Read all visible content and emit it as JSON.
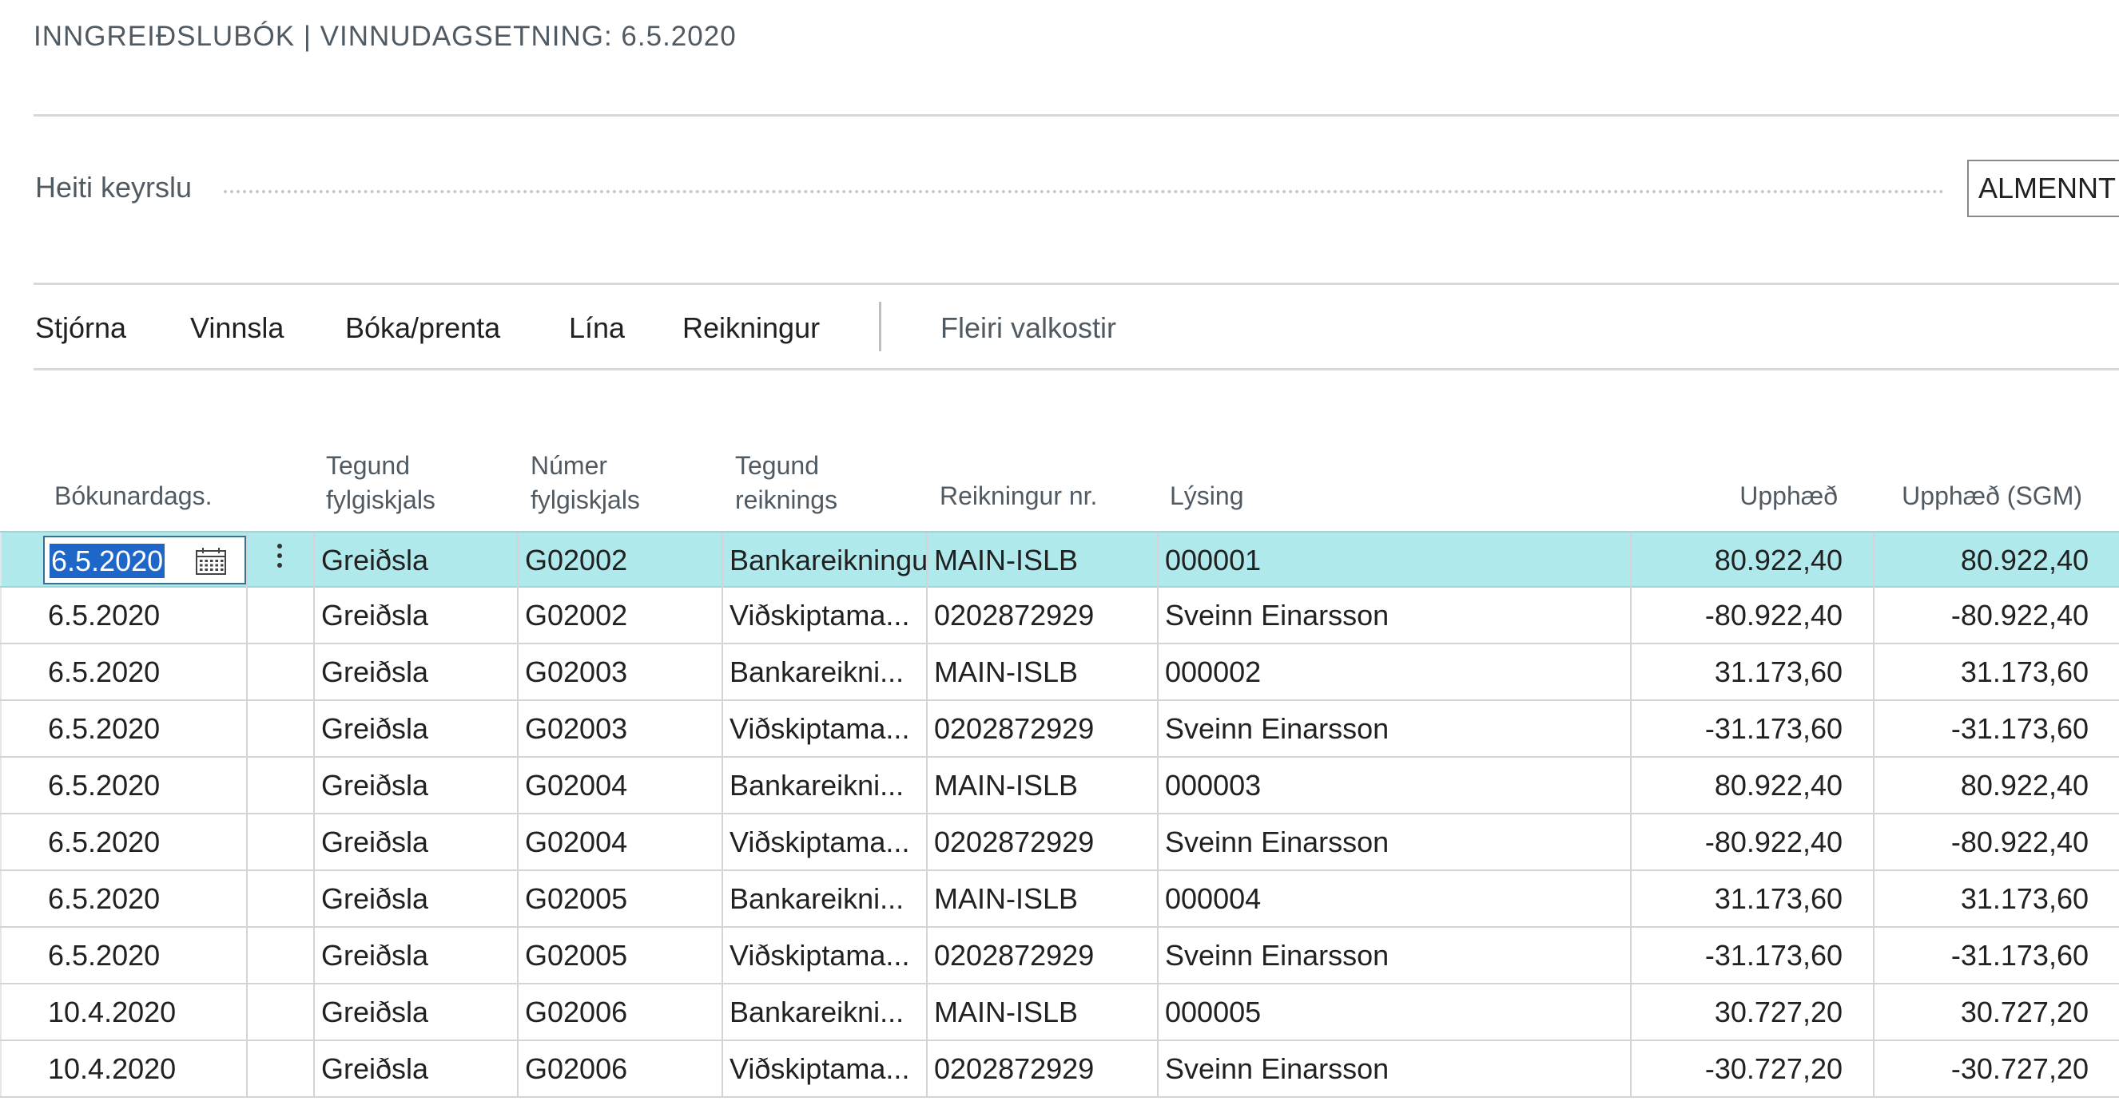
{
  "page": {
    "title": "INNGREIÐSLUBÓK | VINNUDAGSETNING: 6.5.2020"
  },
  "batch": {
    "label": "Heiti keyrslu",
    "value": "ALMENNT"
  },
  "actions": [
    {
      "label": "Stjórna"
    },
    {
      "label": "Vinnsla"
    },
    {
      "label": "Bóka/prenta"
    },
    {
      "label": "Lína"
    },
    {
      "label": "Reikningur"
    },
    {
      "label": "Fleiri valkostir"
    }
  ],
  "columns": {
    "posting_date": "Bókunardags.",
    "doc_type": [
      "Tegund",
      "fylgiskjals"
    ],
    "doc_no": [
      "Númer",
      "fylgiskjals"
    ],
    "account_type": [
      "Tegund",
      "reiknings"
    ],
    "account_no": "Reikningur nr.",
    "description": "Lýsing",
    "amount": "Upphæð",
    "amount_lcy": "Upphæð (SGM)"
  },
  "rows": [
    {
      "date": "6.5.2020",
      "doc_type": "Greiðsla",
      "doc_no": "G02002",
      "acc_type": "Bankareikningur",
      "acc_no": "MAIN-ISLB",
      "desc": "000001",
      "amount": "80.922,40",
      "amount_lcy": "80.922,40"
    },
    {
      "date": "6.5.2020",
      "doc_type": "Greiðsla",
      "doc_no": "G02002",
      "acc_type": "Viðskiptama...",
      "acc_no": "0202872929",
      "desc": "Sveinn Einarsson",
      "amount": "-80.922,40",
      "amount_lcy": "-80.922,40"
    },
    {
      "date": "6.5.2020",
      "doc_type": "Greiðsla",
      "doc_no": "G02003",
      "acc_type": "Bankareikni...",
      "acc_no": "MAIN-ISLB",
      "desc": "000002",
      "amount": "31.173,60",
      "amount_lcy": "31.173,60"
    },
    {
      "date": "6.5.2020",
      "doc_type": "Greiðsla",
      "doc_no": "G02003",
      "acc_type": "Viðskiptama...",
      "acc_no": "0202872929",
      "desc": "Sveinn Einarsson",
      "amount": "-31.173,60",
      "amount_lcy": "-31.173,60"
    },
    {
      "date": "6.5.2020",
      "doc_type": "Greiðsla",
      "doc_no": "G02004",
      "acc_type": "Bankareikni...",
      "acc_no": "MAIN-ISLB",
      "desc": "000003",
      "amount": "80.922,40",
      "amount_lcy": "80.922,40"
    },
    {
      "date": "6.5.2020",
      "doc_type": "Greiðsla",
      "doc_no": "G02004",
      "acc_type": "Viðskiptama...",
      "acc_no": "0202872929",
      "desc": "Sveinn Einarsson",
      "amount": "-80.922,40",
      "amount_lcy": "-80.922,40"
    },
    {
      "date": "6.5.2020",
      "doc_type": "Greiðsla",
      "doc_no": "G02005",
      "acc_type": "Bankareikni...",
      "acc_no": "MAIN-ISLB",
      "desc": "000004",
      "amount": "31.173,60",
      "amount_lcy": "31.173,60"
    },
    {
      "date": "6.5.2020",
      "doc_type": "Greiðsla",
      "doc_no": "G02005",
      "acc_type": "Viðskiptama...",
      "acc_no": "0202872929",
      "desc": "Sveinn Einarsson",
      "amount": "-31.173,60",
      "amount_lcy": "-31.173,60"
    },
    {
      "date": "10.4.2020",
      "doc_type": "Greiðsla",
      "doc_no": "G02006",
      "acc_type": "Bankareikni...",
      "acc_no": "MAIN-ISLB",
      "desc": "000005",
      "amount": "30.727,20",
      "amount_lcy": "30.727,20"
    },
    {
      "date": "10.4.2020",
      "doc_type": "Greiðsla",
      "doc_no": "G02006",
      "acc_type": "Viðskiptama...",
      "acc_no": "0202872929",
      "desc": "Sveinn Einarsson",
      "amount": "-30.727,20",
      "amount_lcy": "-30.727,20"
    }
  ],
  "selected_row": 0,
  "colors": {
    "selected_row_bg": "#b0e9ec",
    "text_selection": "#1e66c8",
    "header_text": "#505a63"
  }
}
